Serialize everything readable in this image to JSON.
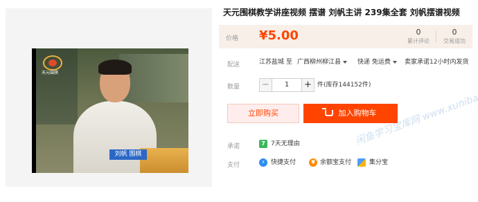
{
  "video": {
    "station_name": "天元围棋",
    "caption": "刘帆  围棋"
  },
  "product": {
    "title": "天元围棋教学讲座视频 摆谱 刘帆主讲 239集全套 刘帆摆谱视频"
  },
  "price": {
    "label": "价格",
    "value": "¥5.00",
    "stats": [
      {
        "num": "0",
        "caption": "累计评论"
      },
      {
        "num": "0",
        "caption": "交易成功"
      }
    ]
  },
  "shipping": {
    "label": "配送",
    "from": "江苏盐城 至",
    "to": "广西柳州柳江县",
    "method": "快递 免运费",
    "promise": "卖家承诺12小时内发货"
  },
  "quantity": {
    "label": "数量",
    "value": "1",
    "minus": "−",
    "plus": "+",
    "stock": "件(库存144152件)"
  },
  "buttons": {
    "buy_now": "立即购买",
    "add_to_cart": "加入购物车"
  },
  "promise": {
    "label": "承诺",
    "badge": "7",
    "text": "7天无理由"
  },
  "payment": {
    "label": "支付",
    "methods": [
      {
        "icon": "quickpay-icon",
        "badge": "⚡",
        "text": "快捷支付"
      },
      {
        "icon": "yuebao-icon",
        "badge": "¥",
        "text": "余额宝支付"
      },
      {
        "icon": "jifenbao-icon",
        "badge": "",
        "text": "集分宝"
      }
    ]
  },
  "watermark": "闲鱼学习宝库网 www.xunibaoku.com"
}
